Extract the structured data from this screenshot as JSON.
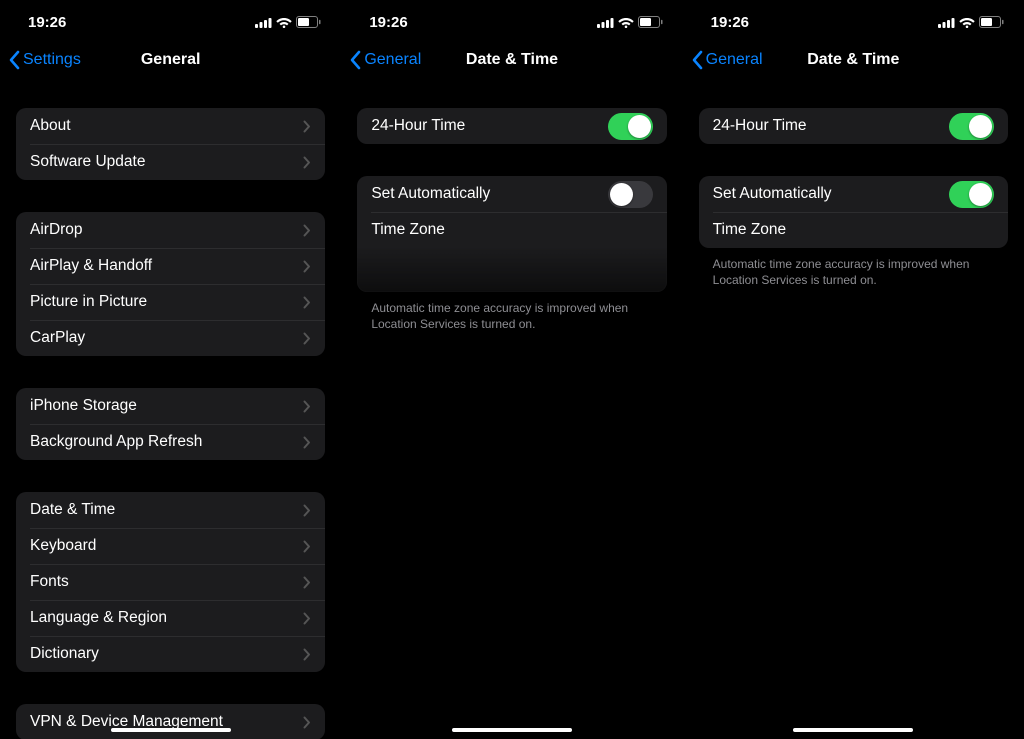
{
  "status": {
    "time": "19:26"
  },
  "screen1": {
    "back": "Settings",
    "title": "General",
    "groups": [
      [
        "About",
        "Software Update"
      ],
      [
        "AirDrop",
        "AirPlay & Handoff",
        "Picture in Picture",
        "CarPlay"
      ],
      [
        "iPhone Storage",
        "Background App Refresh"
      ],
      [
        "Date & Time",
        "Keyboard",
        "Fonts",
        "Language & Region",
        "Dictionary"
      ],
      [
        "VPN & Device Management"
      ]
    ]
  },
  "screen2": {
    "back": "General",
    "title": "Date & Time",
    "row_24h": "24-Hour Time",
    "toggle_24h": true,
    "row_auto": "Set Automatically",
    "toggle_auto": false,
    "row_tz": "Time Zone",
    "footer": "Automatic time zone accuracy is improved when Location Services is turned on."
  },
  "screen3": {
    "back": "General",
    "title": "Date & Time",
    "row_24h": "24-Hour Time",
    "toggle_24h": true,
    "row_auto": "Set Automatically",
    "toggle_auto": true,
    "row_tz": "Time Zone",
    "footer": "Automatic time zone accuracy is improved when Location Services is turned on."
  }
}
